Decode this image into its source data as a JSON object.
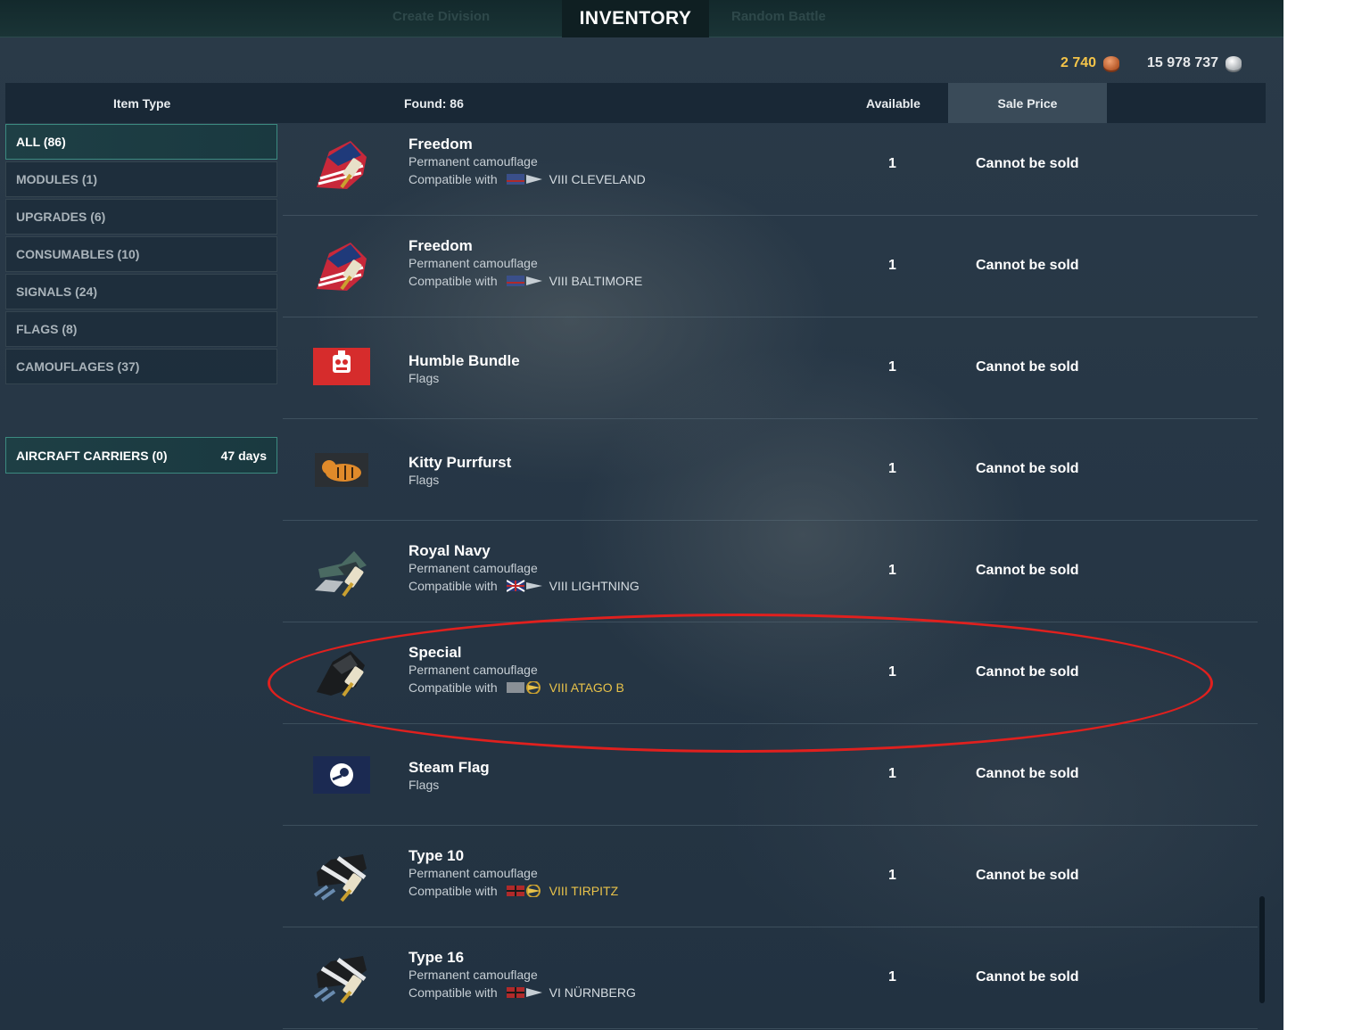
{
  "topbar": {
    "title": "INVENTORY",
    "ghost_left": "Create Division",
    "ghost_right": "Random Battle"
  },
  "currency": {
    "doubloons": "2 740",
    "credits": "15 978 737"
  },
  "table_header": {
    "item_type": "Item Type",
    "found": "Found: 86",
    "available": "Available",
    "sale_price": "Sale Price"
  },
  "sidebar": {
    "items": [
      {
        "label": "ALL (86)"
      },
      {
        "label": "MODULES (1)"
      },
      {
        "label": "UPGRADES (6)"
      },
      {
        "label": "CONSUMABLES (10)"
      },
      {
        "label": "SIGNALS (24)"
      },
      {
        "label": "FLAGS (8)"
      },
      {
        "label": "CAMOUFLAGES (37)"
      }
    ],
    "carriers": {
      "label": "AIRCRAFT CARRIERS (0)",
      "days": "47 days"
    }
  },
  "items": [
    {
      "name": "Freedom",
      "category": "Permanent camouflage",
      "compat_label": "Compatible with",
      "ship": "VIII CLEVELAND",
      "available": "1",
      "price": "Cannot be sold",
      "icon": "usa-camouflage-icon"
    },
    {
      "name": "Freedom",
      "category": "Permanent camouflage",
      "compat_label": "Compatible with",
      "ship": "VIII BALTIMORE",
      "available": "1",
      "price": "Cannot be sold",
      "icon": "usa-camouflage-icon"
    },
    {
      "name": "Humble Bundle",
      "category": "Flags",
      "available": "1",
      "price": "Cannot be sold",
      "icon": "humble-bundle-flag-icon"
    },
    {
      "name": "Kitty Purrfurst",
      "category": "Flags",
      "available": "1",
      "price": "Cannot be sold",
      "icon": "kitty-flag-icon"
    },
    {
      "name": "Royal Navy",
      "category": "Permanent camouflage",
      "compat_label": "Compatible with",
      "ship": "VIII LIGHTNING",
      "available": "1",
      "price": "Cannot be sold",
      "icon": "royal-navy-camouflage-icon"
    },
    {
      "name": "Special",
      "category": "Permanent camouflage",
      "compat_label": "Compatible with",
      "ship": "VIII ATAGO B",
      "available": "1",
      "price": "Cannot be sold",
      "icon": "special-camouflage-icon"
    },
    {
      "name": "Steam Flag",
      "category": "Flags",
      "available": "1",
      "price": "Cannot be sold",
      "icon": "steam-flag-icon"
    },
    {
      "name": "Type 10",
      "category": "Permanent camouflage",
      "compat_label": "Compatible with",
      "ship": "VIII TIRPITZ",
      "available": "1",
      "price": "Cannot be sold",
      "icon": "type-camouflage-icon"
    },
    {
      "name": "Type 16",
      "category": "Permanent camouflage",
      "compat_label": "Compatible with",
      "ship": "VI NÜRNBERG",
      "available": "1",
      "price": "Cannot be sold",
      "icon": "type-camouflage-icon"
    }
  ],
  "colors": {
    "accent_teal": "#3c8a80",
    "premium_gold": "#e8c24a",
    "doubloon_gold": "#f4c449",
    "annotation_red": "#e0201e"
  }
}
